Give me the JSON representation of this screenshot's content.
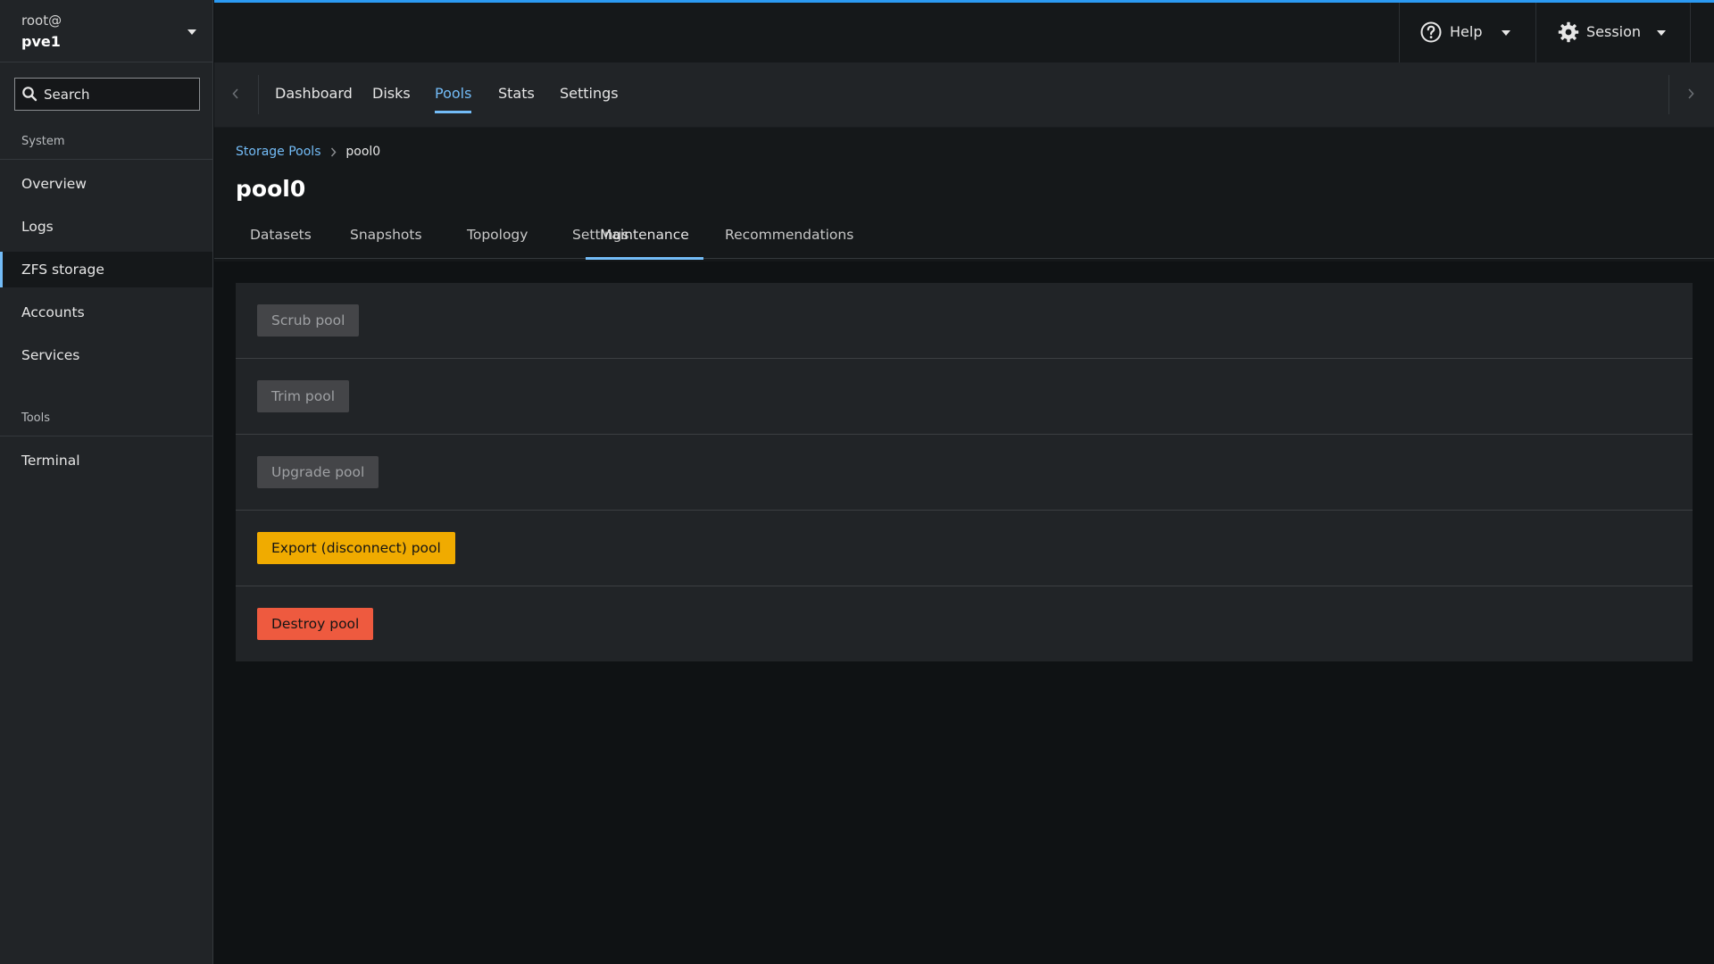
{
  "sidebar": {
    "host": {
      "user": "root@",
      "name": "pve1"
    },
    "search": {
      "placeholder": "Search"
    },
    "groups": [
      {
        "title": "System",
        "items": [
          "Overview",
          "Logs",
          "ZFS storage",
          "Accounts",
          "Services"
        ]
      },
      {
        "title": "Tools",
        "items": [
          "Terminal"
        ]
      }
    ],
    "active_item": "ZFS storage"
  },
  "topbar": {
    "help_label": "Help",
    "session_label": "Session",
    "accent_color": "#2b9af3"
  },
  "tabs": {
    "items": [
      "Dashboard",
      "Disks",
      "Pools",
      "Stats",
      "Settings"
    ],
    "active": "Pools"
  },
  "breadcrumb": {
    "parent": "Storage Pools",
    "current": "pool0"
  },
  "page": {
    "title": "pool0",
    "subtabs": [
      "Datasets",
      "Snapshots",
      "Topology",
      "Settings",
      "Maintenance",
      "Recommendations"
    ],
    "active_subtab": "Maintenance"
  },
  "maintenance": {
    "buttons": [
      {
        "label": "Scrub pool",
        "state": "disabled"
      },
      {
        "label": "Trim pool",
        "state": "disabled"
      },
      {
        "label": "Upgrade pool",
        "state": "disabled"
      },
      {
        "label": "Export (disconnect) pool",
        "state": "warning",
        "color": "#f0ab00"
      },
      {
        "label": "Destroy pool",
        "state": "danger",
        "color": "#ee5a3f"
      }
    ]
  }
}
